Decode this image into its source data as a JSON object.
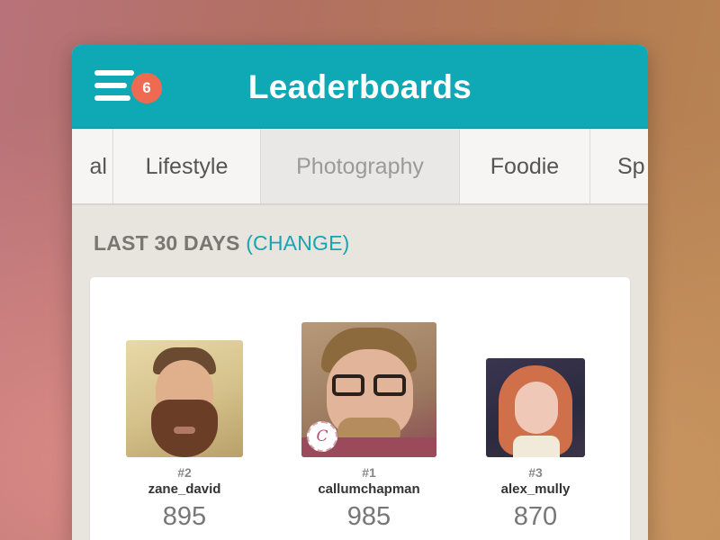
{
  "header": {
    "title": "Leaderboards",
    "notification_count": "6"
  },
  "tabs": [
    {
      "label": "al"
    },
    {
      "label": "Lifestyle"
    },
    {
      "label": "Photography"
    },
    {
      "label": "Foodie"
    },
    {
      "label": "Sp"
    }
  ],
  "range": {
    "label": "LAST 30 DAYS",
    "change_label": "(CHANGE)"
  },
  "leaders": [
    {
      "rank": "#2",
      "username": "zane_david",
      "score": "895"
    },
    {
      "rank": "#1",
      "username": "callumchapman",
      "score": "985",
      "logo_text": "C"
    },
    {
      "rank": "#3",
      "username": "alex_mully",
      "score": "870"
    }
  ],
  "colors": {
    "header": "#0fa8b5",
    "badge": "#ee6b52",
    "accent_link": "#17a5b3"
  }
}
